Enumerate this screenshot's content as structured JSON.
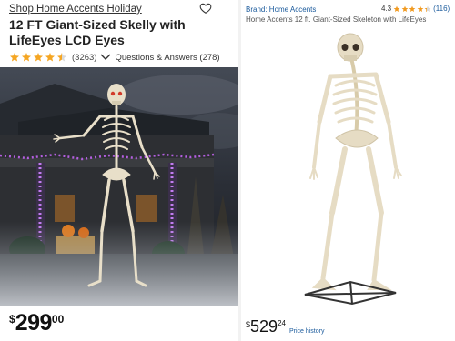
{
  "left": {
    "shop_link": "Shop Home Accents Holiday",
    "title_line1": "12 FT Giant-Sized Skelly with",
    "title_line2": "LifeEyes LCD Eyes",
    "rating": {
      "stars": 4.5,
      "count": "(3263)"
    },
    "qa_link": "Questions & Answers (278)",
    "price": {
      "currency": "$",
      "dollars": "299",
      "cents": "00"
    },
    "icons": {
      "wishlist": "heart-outline-icon",
      "expand": "chevron-down-icon",
      "stars": "star-icon"
    }
  },
  "right": {
    "brand": "Brand: Home Accents",
    "rating": {
      "value": "4.3",
      "stars": 4.3,
      "count": "(116)"
    },
    "title": "Home Accents 12 ft. Giant-Sized Skeleton with LifeEyes",
    "price": {
      "currency": "$",
      "dollars": "529",
      "cents": "24"
    },
    "price_history": "Price history"
  },
  "colors": {
    "star_left": "#f5a623",
    "star_right": "#f19a20",
    "link_blue": "#1a5a9c",
    "night_sky": "#2b2f36",
    "bone": "#e6dcc4"
  }
}
